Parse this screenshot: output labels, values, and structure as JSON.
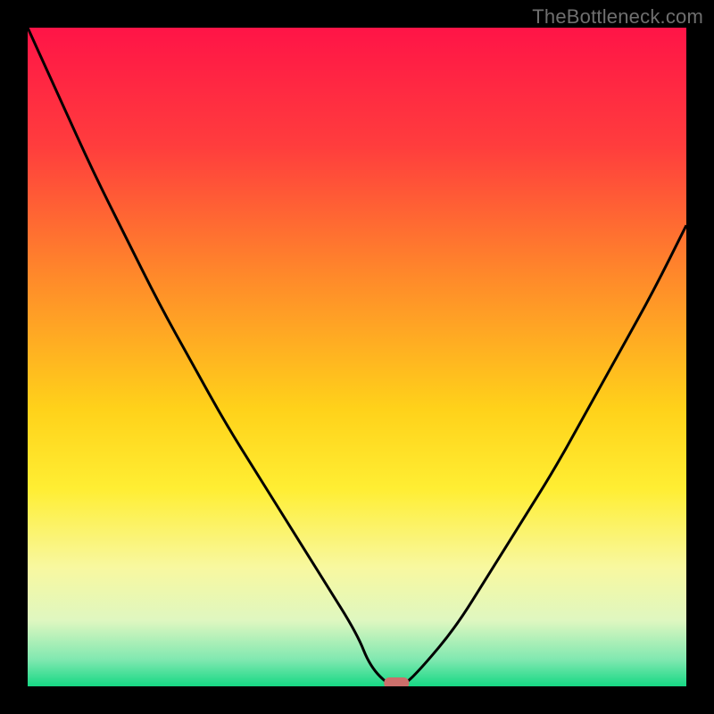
{
  "watermark": "TheBottleneck.com",
  "chart_data": {
    "type": "line",
    "title": "",
    "xlabel": "",
    "ylabel": "",
    "xlim": [
      0,
      100
    ],
    "ylim": [
      0,
      100
    ],
    "x": [
      0,
      5,
      10,
      15,
      20,
      25,
      30,
      35,
      40,
      45,
      50,
      52,
      55,
      57,
      60,
      65,
      70,
      75,
      80,
      85,
      90,
      95,
      100
    ],
    "values": [
      100,
      89,
      78,
      68,
      58,
      49,
      40,
      32,
      24,
      16,
      8,
      3,
      0,
      0,
      3,
      9,
      17,
      25,
      33,
      42,
      51,
      60,
      70
    ],
    "marker": {
      "x": 56,
      "y": 0
    },
    "gradient_stops": [
      {
        "offset": 0.0,
        "color": "#ff1447"
      },
      {
        "offset": 0.18,
        "color": "#ff3d3d"
      },
      {
        "offset": 0.38,
        "color": "#ff8a2a"
      },
      {
        "offset": 0.58,
        "color": "#ffd21a"
      },
      {
        "offset": 0.7,
        "color": "#ffee33"
      },
      {
        "offset": 0.82,
        "color": "#f8f8a0"
      },
      {
        "offset": 0.9,
        "color": "#dff7c0"
      },
      {
        "offset": 0.96,
        "color": "#7fe8b0"
      },
      {
        "offset": 1.0,
        "color": "#16d884"
      }
    ],
    "marker_color": "#cc6f6b",
    "line_color": "#000000"
  }
}
